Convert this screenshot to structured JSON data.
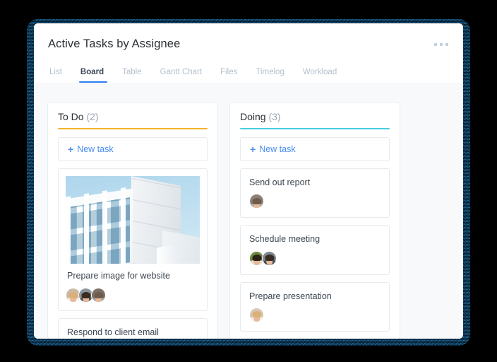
{
  "header": {
    "title": "Active Tasks by Assignee",
    "more_menu_icon": "ellipsis-horizontal-icon",
    "tabs": [
      {
        "label": "List",
        "active": false
      },
      {
        "label": "Board",
        "active": true
      },
      {
        "label": "Table",
        "active": false
      },
      {
        "label": "Gantt Chart",
        "active": false
      },
      {
        "label": "Files",
        "active": false
      },
      {
        "label": "Timelog",
        "active": false
      },
      {
        "label": "Workload",
        "active": false
      }
    ],
    "active_tab_accent": "#2d7ff0"
  },
  "board": {
    "background": "#f7f9fb",
    "columns": [
      {
        "name": "To Do",
        "count": "(2)",
        "accent": "#f5b228",
        "new_task_label": "New task",
        "new_task_plus": "+",
        "cards": [
          {
            "title": "Prepare image for website",
            "has_image": true,
            "image_alt": "white-modern-building-against-blue-sky",
            "assignees": [
              {
                "name": "assignee-1",
                "bg": "#cbb9a4",
                "hair": "#d9b178",
                "body": "#f1ebe3"
              },
              {
                "name": "assignee-2",
                "bg": "#8b949c",
                "hair": "#3a2b22",
                "body": "#3e4a52"
              },
              {
                "name": "assignee-3",
                "bg": "#7c7166",
                "hair": "#6d5c4c",
                "body": "#9aa3a8"
              }
            ]
          },
          {
            "title": "Respond to client email",
            "has_image": false,
            "assignees": []
          }
        ]
      },
      {
        "name": "Doing",
        "count": "(3)",
        "accent": "#46cfe0",
        "new_task_label": "New task",
        "new_task_plus": "+",
        "cards": [
          {
            "title": "Send out report",
            "has_image": false,
            "assignees": [
              {
                "name": "assignee-3",
                "bg": "#8d8176",
                "hair": "#6d5c4c",
                "body": "#a6aeb2"
              }
            ]
          },
          {
            "title": "Schedule meeting",
            "has_image": false,
            "assignees": [
              {
                "name": "assignee-4",
                "bg": "#6d8a3c",
                "hair": "#2b2118",
                "body": "#e9dfd2"
              },
              {
                "name": "assignee-2",
                "bg": "#7d8790",
                "hair": "#3a2b22",
                "body": "#3e4a52"
              }
            ]
          },
          {
            "title": "Prepare presentation",
            "has_image": false,
            "assignees": [
              {
                "name": "assignee-1",
                "bg": "#d7c7b4",
                "hair": "#d9b178",
                "body": "#f3ece4"
              }
            ]
          }
        ]
      }
    ]
  },
  "photo_colors": {
    "sky": "#b5d9ee",
    "building_light": "#fbfcfd",
    "glass": "#a0c4d8"
  }
}
